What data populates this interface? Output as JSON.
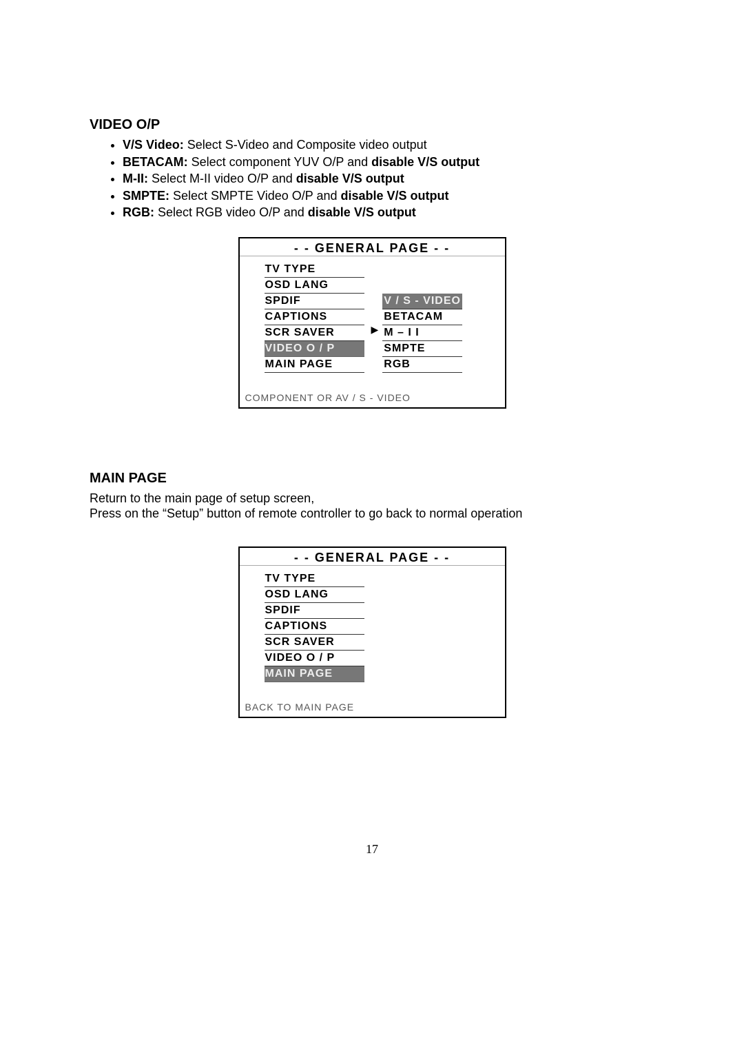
{
  "sections": {
    "video_op": {
      "heading": "VIDEO O/P",
      "bullets": [
        {
          "label": "V/S Video:",
          "text": " Select S-Video and Composite video output",
          "bold_tail": ""
        },
        {
          "label": "BETACAM:",
          "text": " Select component YUV O/P and ",
          "bold_tail": "disable V/S output"
        },
        {
          "label": "M-II:",
          "text": " Select M-II video O/P and ",
          "bold_tail": "disable V/S output"
        },
        {
          "label": "SMPTE:",
          "text": " Select SMPTE Video O/P and ",
          "bold_tail": "disable V/S output"
        },
        {
          "label": "RGB:",
          "text": " Select RGB video O/P and ",
          "bold_tail": "disable V/S output"
        }
      ]
    },
    "main_page": {
      "heading": "MAIN PAGE",
      "para1": "Return to the main page of setup screen,",
      "para2": "Press on the “Setup” button of remote controller to go back to normal operation"
    }
  },
  "osd1": {
    "title": "- -   GENERAL  PAGE   - -",
    "left": [
      "TV TYPE",
      "OSD LANG",
      "SPDIF",
      "CAPTIONS",
      "SCR SAVER",
      "VIDEO O / P",
      "MAIN PAGE"
    ],
    "left_selected_index": 5,
    "right": [
      "V / S - VIDEO",
      "BETACAM",
      "M – I I",
      "SMPTE",
      "RGB"
    ],
    "right_selected_index": 0,
    "help": "COMPONENT OR AV / S - VIDEO"
  },
  "osd2": {
    "title": "- -   GENERAL  PAGE   - -",
    "left": [
      "TV TYPE",
      "OSD LANG",
      "SPDIF",
      "CAPTIONS",
      "SCR SAVER",
      "VIDEO  O / P",
      "MAIN  PAGE"
    ],
    "left_selected_index": 6,
    "help": "BACK TO MAIN PAGE"
  },
  "page_number": "17"
}
